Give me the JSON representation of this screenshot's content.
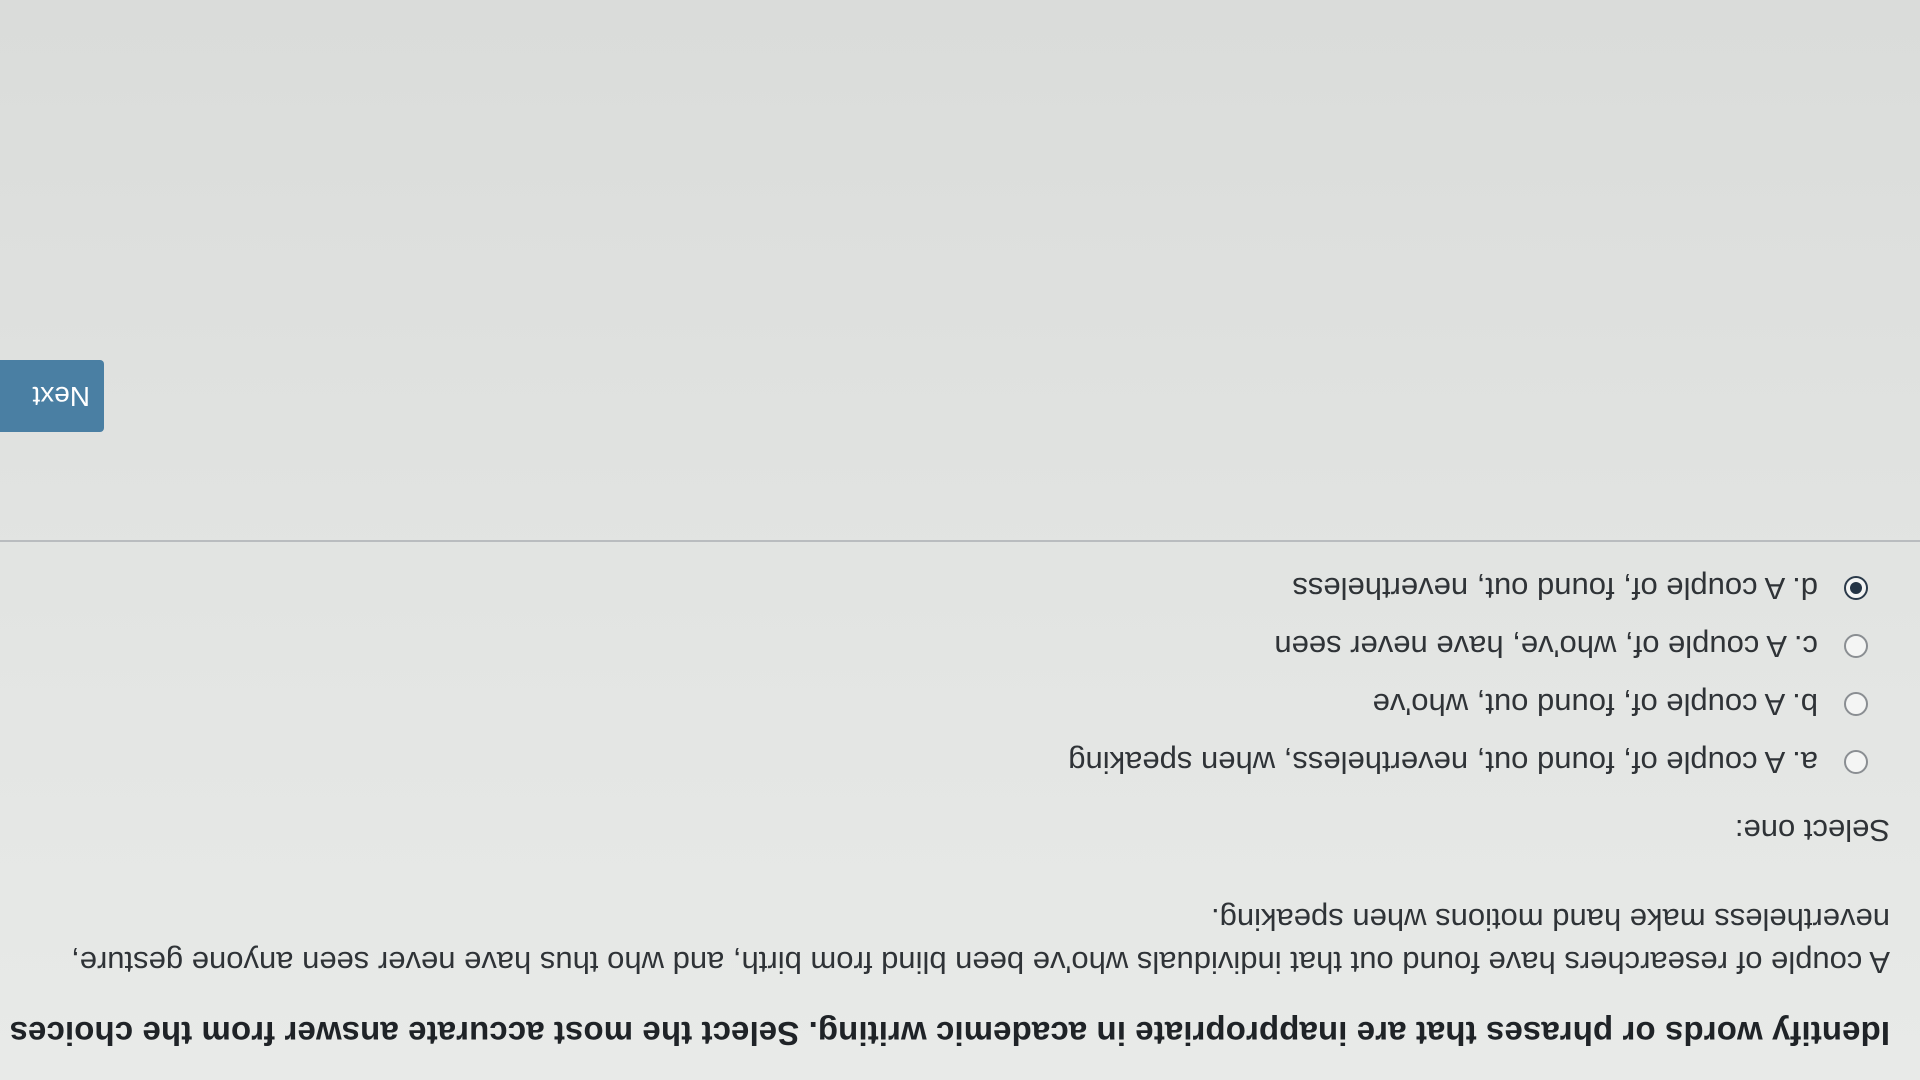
{
  "question": {
    "title": "Identify words or phrases that are inappropriate in academic writing. Select the most accurate answer from the choices given.",
    "passage": "A couple of researchers have found out that individuals who've been blind from birth, and who thus have never seen anyone gesture, nevertheless make hand motions when speaking.",
    "select_label": "Select one:",
    "options": [
      {
        "label": "a. A couple of, found out, nevertheless, when speaking",
        "selected": false
      },
      {
        "label": "b. A couple of, found out, who've",
        "selected": false
      },
      {
        "label": "c. A couple of, who've, have never seen",
        "selected": false
      },
      {
        "label": "d. A couple of, found out, nevertheless",
        "selected": true
      }
    ]
  },
  "navigation": {
    "next_label": "Next"
  },
  "colors": {
    "next_button": "#4a7fa3",
    "selected_radio": "#243445"
  }
}
